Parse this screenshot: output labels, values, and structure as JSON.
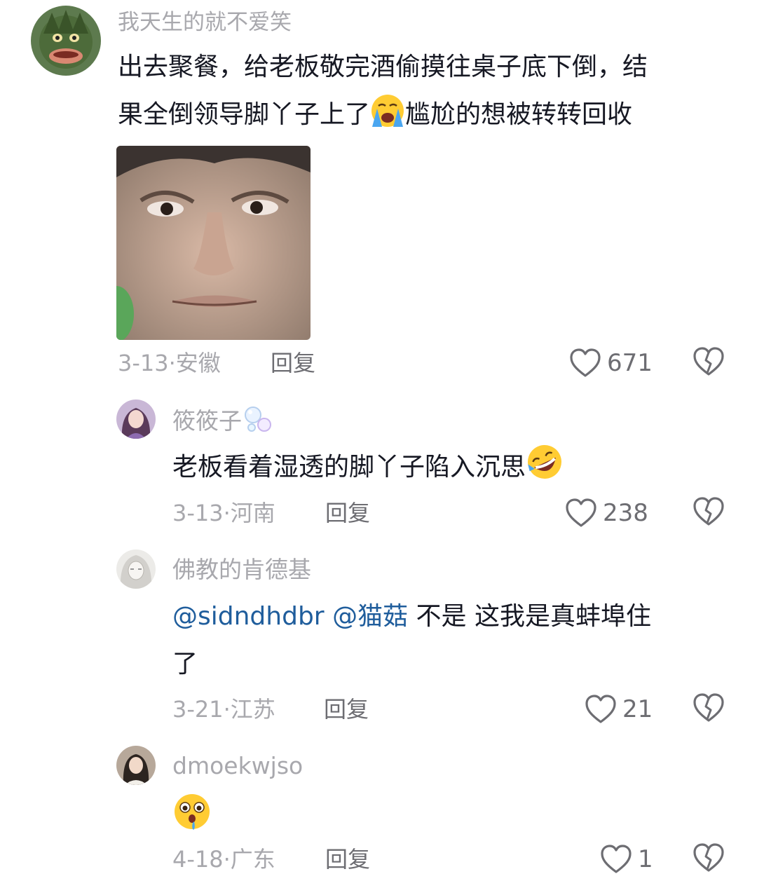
{
  "comments": [
    {
      "username": "我天生的就不爱笑",
      "text": "出去聚餐，给老板敬完酒偷摸往桌子底下倒，结果全倒领导脚丫子上了😭尴尬的想被转转回收",
      "text_part1": "出去聚餐，给老板敬完酒偷摸往桌子底下倒，结",
      "text_part2a": "果全倒领导脚丫子上了",
      "text_part2b": "尴尬的想被转转回收",
      "emoji": "loudly-crying-face",
      "date": "3-13",
      "location": "安徽",
      "reply_label": "回复",
      "likes": "671",
      "has_image": true
    },
    {
      "username": "筱筱子",
      "username_emoji": "bubbles",
      "text": "老板看着湿透的脚丫子陷入沉思🤣",
      "text_main": "老板看着湿透的脚丫子陷入沉思",
      "emoji": "rolling-on-floor-laughing",
      "date": "3-13",
      "location": "河南",
      "reply_label": "回复",
      "likes": "238"
    },
    {
      "username": "佛教的肯德基",
      "mention1": "@sidndhdbr",
      "mention2": "@猫菇",
      "text_line1": "不是 这我是真蚌埠住",
      "text_line2": "了",
      "date": "3-21",
      "location": "江苏",
      "reply_label": "回复",
      "likes": "21"
    },
    {
      "username": "dmoekwjso",
      "emoji": "drooling-face",
      "date": "4-18",
      "location": "广东",
      "reply_label": "回复",
      "likes": "1"
    }
  ],
  "colors": {
    "meta": "#a8a8ad",
    "mention": "#1f5d9c",
    "text": "#161823"
  }
}
